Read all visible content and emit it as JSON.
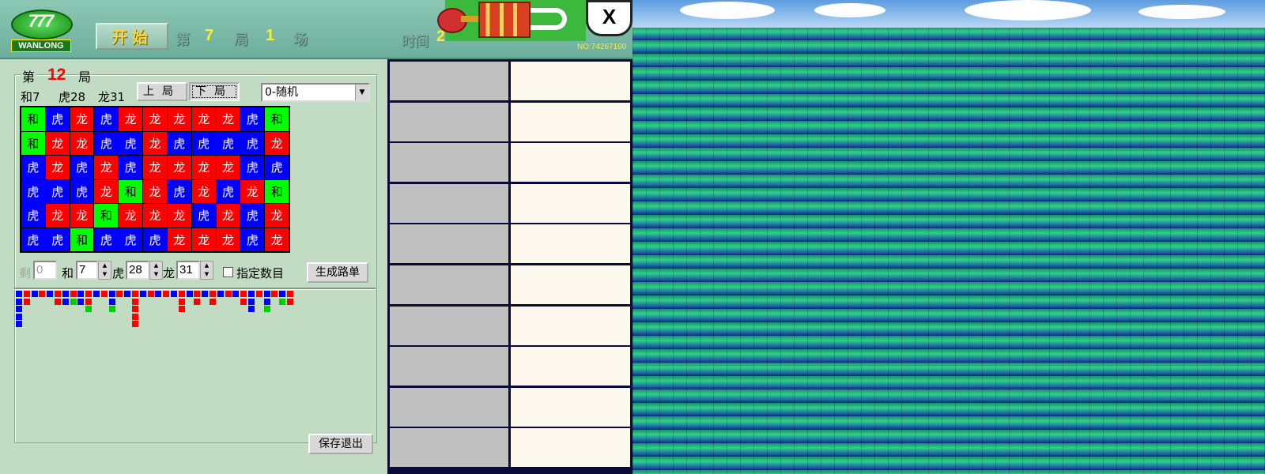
{
  "topbar": {
    "logo_mark": "777",
    "logo_brand": "WANLONG",
    "start_button": "开始",
    "di": "第",
    "ju_number": "7",
    "ju": "局",
    "chang_number": "1",
    "chang": "场",
    "timer_label": "时间",
    "timer_value": "25",
    "close_label": "X",
    "serial": "NO:74267160"
  },
  "editor": {
    "legend_di": "第",
    "round_number": "12",
    "legend_ju": "局",
    "count_tie": "和7",
    "count_tiger": "虎28",
    "count_dragon": "龙31",
    "prev_button": "上局",
    "next_button": "下局",
    "mode_value": "0-随机",
    "grid": [
      [
        "和",
        "虎",
        "龙",
        "虎",
        "龙",
        "龙",
        "龙",
        "龙",
        "龙",
        "虎",
        "和"
      ],
      [
        "和",
        "龙",
        "龙",
        "虎",
        "虎",
        "龙",
        "虎",
        "虎",
        "虎",
        "虎",
        "龙"
      ],
      [
        "虎",
        "龙",
        "虎",
        "龙",
        "虎",
        "龙",
        "龙",
        "龙",
        "龙",
        "虎",
        "虎"
      ],
      [
        "虎",
        "虎",
        "虎",
        "龙",
        "和",
        "龙",
        "虎",
        "龙",
        "虎",
        "龙",
        "和"
      ],
      [
        "虎",
        "龙",
        "龙",
        "和",
        "龙",
        "龙",
        "龙",
        "虎",
        "龙",
        "虎",
        "龙"
      ],
      [
        "虎",
        "虎",
        "和",
        "虎",
        "虎",
        "虎",
        "龙",
        "龙",
        "龙",
        "虎",
        "龙"
      ]
    ],
    "remain_label": "剩",
    "remain_value": "0",
    "tie_label": "和",
    "tie_value": "7",
    "tiger_label": "虎",
    "tiger_value": "28",
    "dragon_label": "龙",
    "dragon_value": "31",
    "specify_label": "指定数目",
    "generate_button": "生成路单",
    "save_button": "保存退出"
  },
  "colors": {
    "tiger": "#0000ff",
    "dragon": "#ff0000",
    "tie": "#00ff00",
    "highlight": "#ffef2a"
  }
}
